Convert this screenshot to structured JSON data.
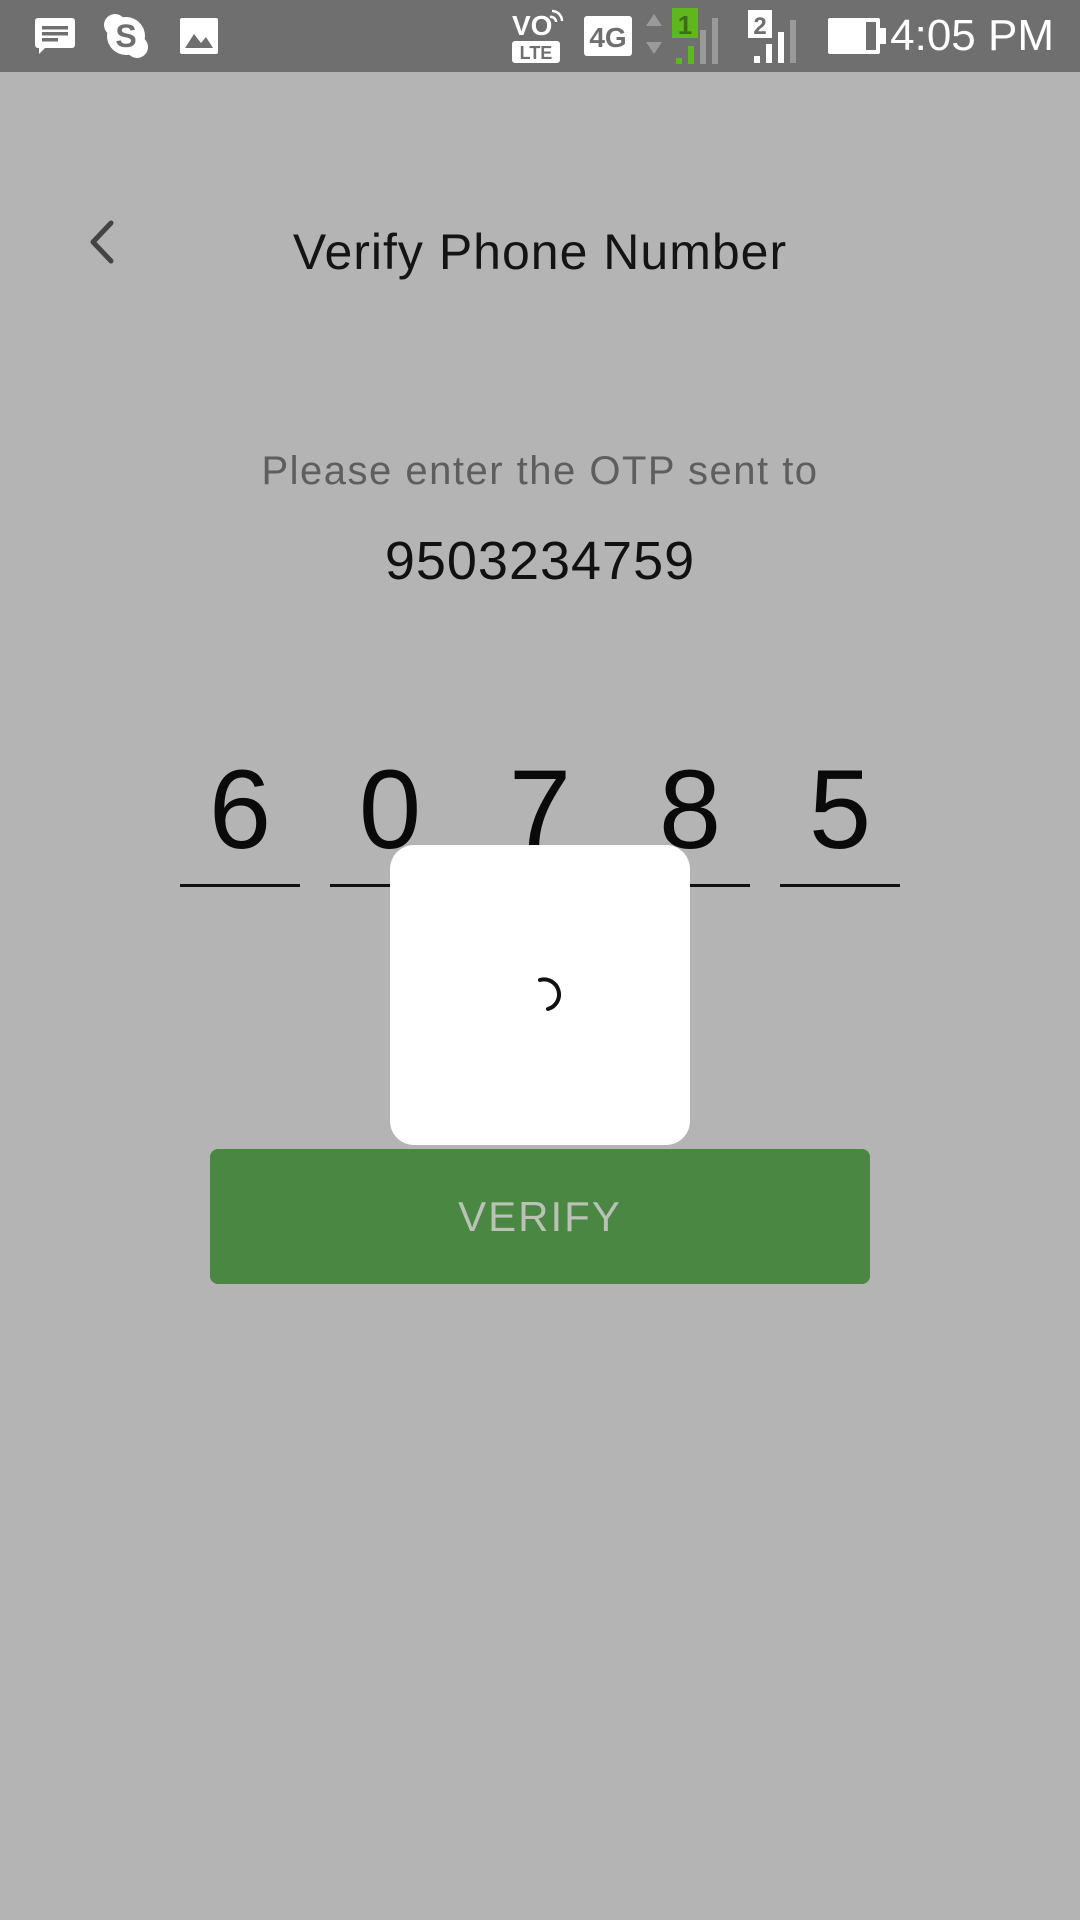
{
  "status_bar": {
    "time": "4:05 PM",
    "notification_icons": [
      "message-icon",
      "skype-icon",
      "gallery-icon"
    ],
    "network_labels": {
      "volte_top": "VO",
      "volte_bottom": "LTE",
      "network_type": "4G",
      "sim1": "1",
      "sim2": "2"
    }
  },
  "header": {
    "title": "Verify Phone Number",
    "back_icon": "chevron-left-icon"
  },
  "prompt": {
    "text": "Please enter the OTP sent to",
    "phone_number": "9503234759"
  },
  "otp": {
    "digits": [
      "6",
      "0",
      "7",
      "8",
      "5"
    ]
  },
  "verify_button": {
    "label": "VERIFY",
    "color": "#4a8742"
  },
  "loading_dialog": {
    "icon": "spinner-icon"
  },
  "colors": {
    "background": "#b4b4b4",
    "status_bar": "#6f6f6f",
    "sim1_signal": "#5fb71e"
  }
}
